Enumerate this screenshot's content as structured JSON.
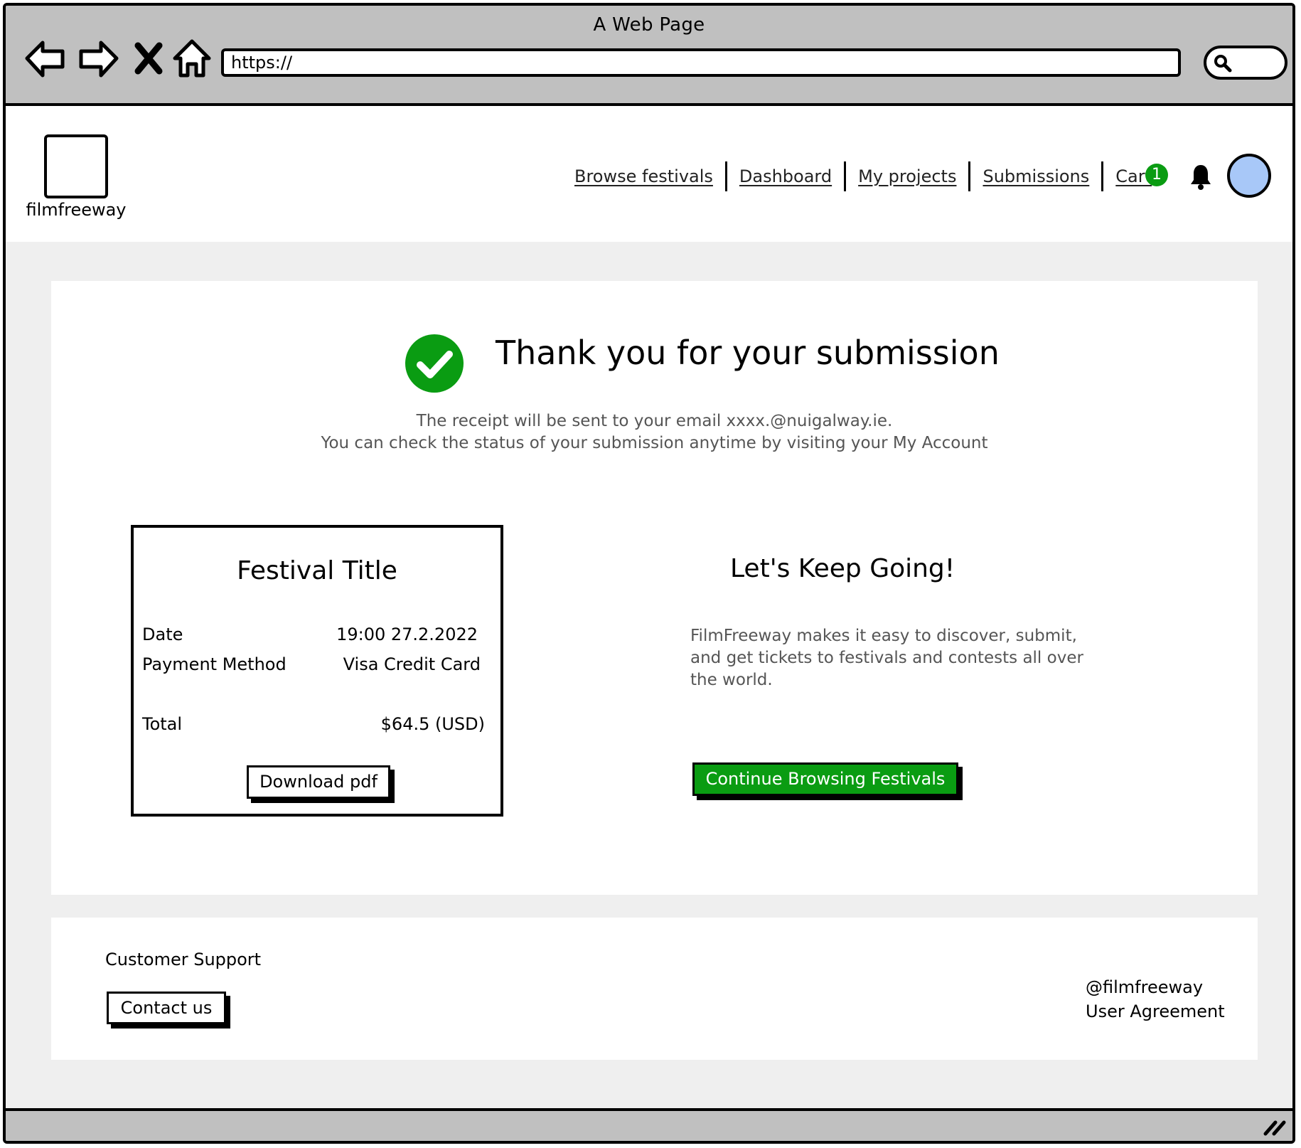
{
  "window": {
    "title": "A Web Page",
    "url": "https://"
  },
  "icons": {
    "back": "back-arrow-icon",
    "forward": "forward-arrow-icon",
    "stop": "close-icon",
    "home": "home-icon",
    "search": "search-icon",
    "success": "check-circle-icon",
    "bell": "bell-icon",
    "resize": "resize-grip-icon"
  },
  "header": {
    "logo_text": "filmfreeway",
    "nav": [
      {
        "label": "Browse festivals"
      },
      {
        "label": "Dashboard"
      },
      {
        "label": "My projects"
      },
      {
        "label": "Submissions"
      },
      {
        "label": "Cart"
      }
    ],
    "cart_count": "1"
  },
  "confirmation": {
    "headline": "Thank you for your submission",
    "line1": "The receipt will be sent to your email xxxx.@nuigalway.ie.",
    "line2": "You can check the status of your submission anytime by visiting your My Account"
  },
  "receipt": {
    "title": "Festival Title",
    "date_label": "Date",
    "date_value": "19:00 27.2.2022",
    "payment_label": "Payment Method",
    "payment_value": "Visa Credit Card",
    "total_label": "Total",
    "total_value": "$64.5 (USD)",
    "download_label": "Download pdf"
  },
  "keep_going": {
    "title": "Let's Keep Going!",
    "description": "FilmFreeway makes it easy to discover, submit, and get tickets to festivals and contests all over the world.",
    "button_label": "Continue Browsing Festivals"
  },
  "footer": {
    "support_label": "Customer Support",
    "contact_label": "Contact us",
    "handle": "@filmfreeway",
    "agreement": "User Agreement"
  },
  "colors": {
    "accent_green": "#0a9c12",
    "avatar_blue": "#a8c8f8",
    "chrome_gray": "#c0c0c0",
    "page_bg": "#efefef"
  }
}
